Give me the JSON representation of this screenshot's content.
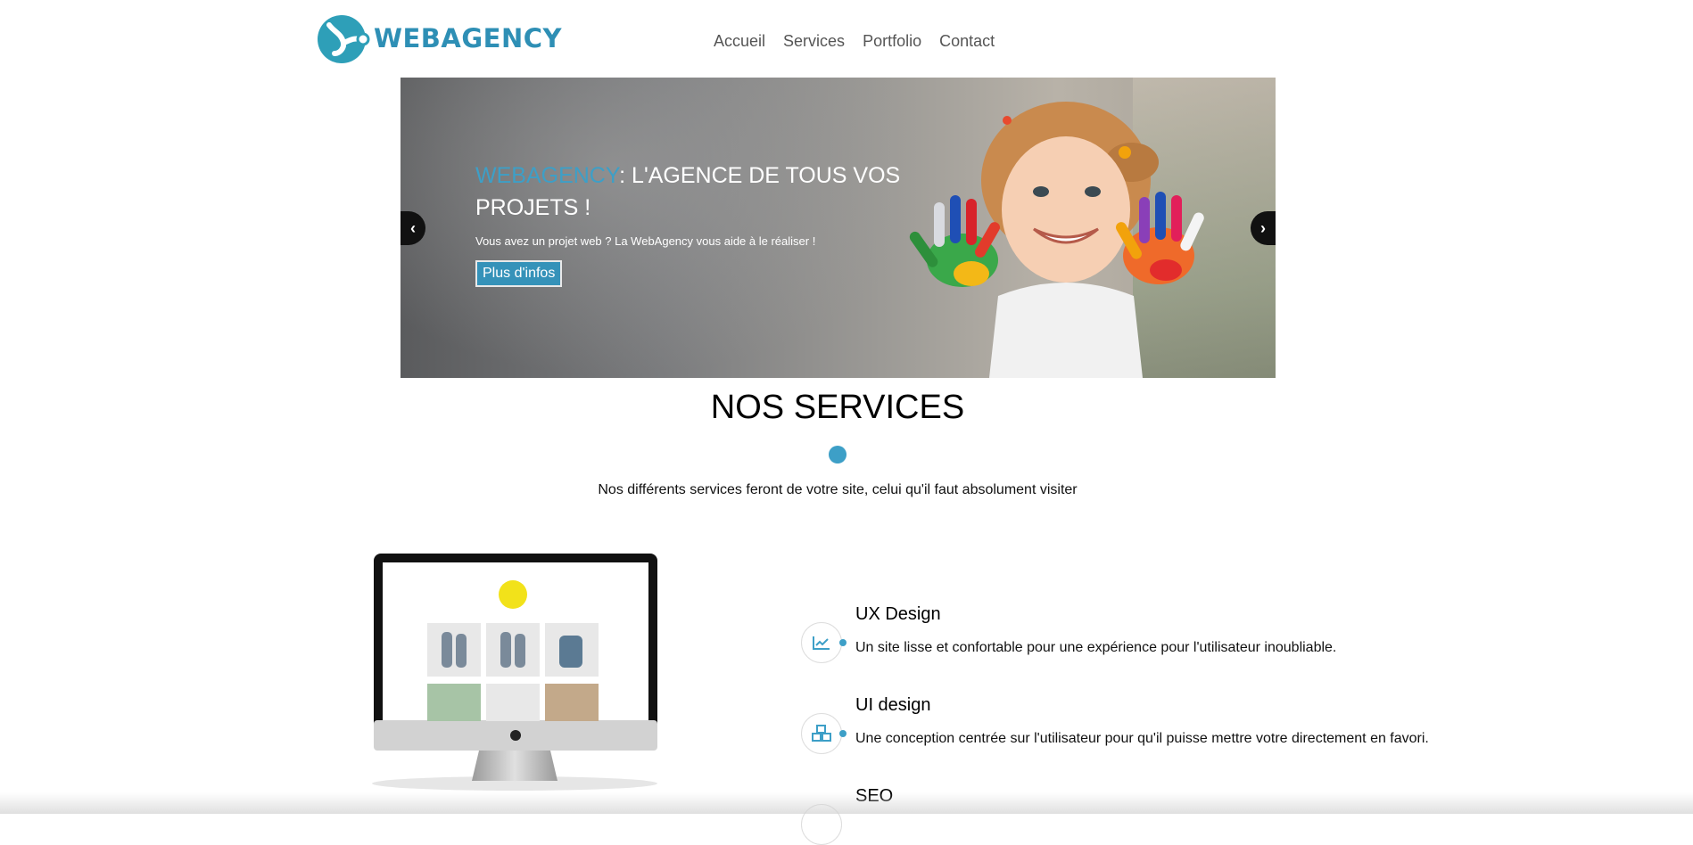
{
  "header": {
    "logo_text": "WEBAGENCY",
    "nav": [
      "Accueil",
      "Services",
      "Portfolio",
      "Contact"
    ]
  },
  "hero": {
    "title_accent": "WEBAGENCY",
    "title_rest": ": L'AGENCE DE TOUS VOS PROJETS !",
    "subtitle": "Vous avez un projet web ? La WebAgency vous aide à le réaliser !",
    "button_label": "Plus d'infos",
    "prev_label": "‹",
    "next_label": "›"
  },
  "services": {
    "title": "NOS SERVICES",
    "description": "Nos différents services feront de votre site, celui qu'il faut absolument visiter",
    "items": [
      {
        "title": "UX Design",
        "text": "Un site lisse et confortable pour une expérience pour l'utilisateur inoubliable.",
        "icon": "chart-icon"
      },
      {
        "title": "UI design",
        "text": "Une conception centrée sur l'utilisateur pour qu'il puisse mettre votre directement en favori.",
        "icon": "cubes-icon"
      },
      {
        "title": "SEO",
        "text": "",
        "icon": "seo-icon"
      }
    ]
  },
  "colors": {
    "accent": "#3d9fc7",
    "brand": "#2e8fb5",
    "button": "#3592b9"
  }
}
